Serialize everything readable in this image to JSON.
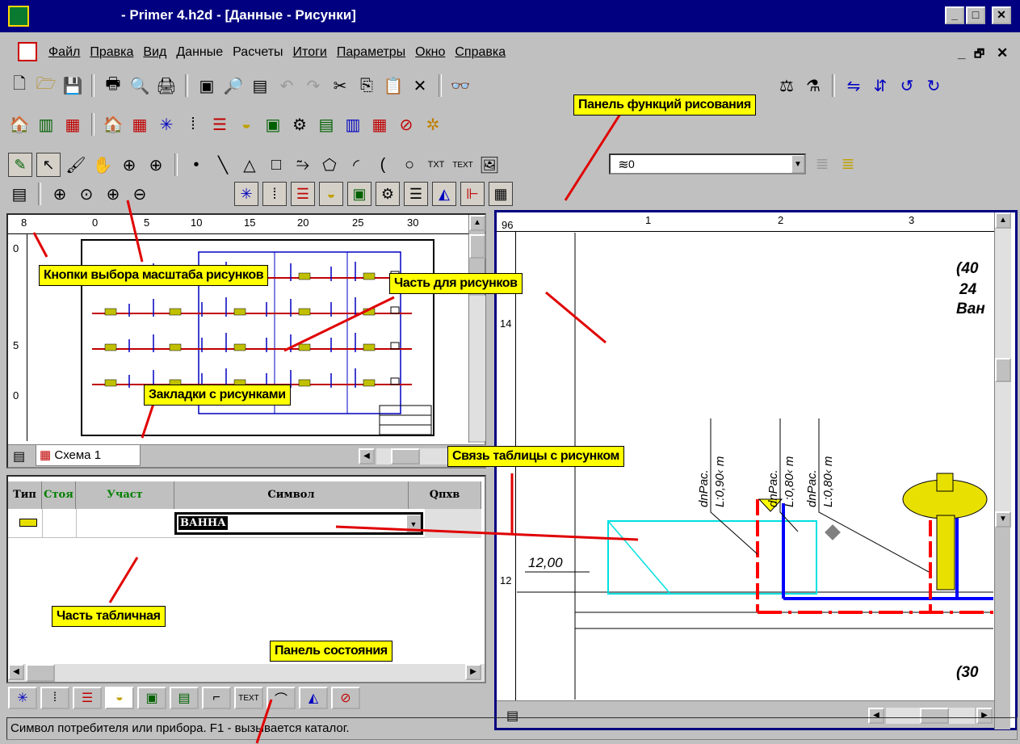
{
  "window": {
    "title": "- Primer 4.h2d - [Данные - Рисунки]",
    "min": "_",
    "max": "□",
    "close": "✕"
  },
  "menu": {
    "items": [
      "Файл",
      "Правка",
      "Вид",
      "Данные",
      "Расчеты",
      "Итоги",
      "Параметры",
      "Окно",
      "Справка"
    ],
    "mdi_min": "_",
    "mdi_restore": "🗗",
    "mdi_close": "✕"
  },
  "toolbar": {
    "layer_value": "0"
  },
  "left_pane": {
    "ruler_top": [
      "8",
      "0",
      "5",
      "10",
      "15",
      "20",
      "25",
      "30"
    ],
    "ruler_side": [
      "0",
      "5",
      "0"
    ],
    "tab_label": "Схема 1"
  },
  "right_pane": {
    "ruler_top": [
      "96",
      "1",
      "2",
      "3"
    ],
    "ruler_side": [
      "14",
      "12"
    ],
    "drawing_texts": {
      "num40": "(40",
      "line2": "24",
      "line3": "Ван",
      "num30": "(30",
      "elev": "12,00",
      "pipe1_a": "dnPac.",
      "pipe1_b": "L:0,90‹ m",
      "pipe2_a": "dnPac.",
      "pipe2_b": "L:0,80‹ m",
      "pipe3_a": "dnPac.",
      "pipe3_b": "L:0,80‹ m"
    }
  },
  "table": {
    "headers": [
      "Тип",
      "Стоя",
      "Участ",
      "Символ",
      "Qпхв"
    ],
    "row_value": "ВАННА"
  },
  "annotations": {
    "drawing_functions": "Панель функций рисования",
    "scale_buttons": "Кнопки выбора масштаба рисунков",
    "drawing_part": "Часть для рисунков",
    "drawing_tabs": "Закладки с рисунками",
    "table_link": "Связь таблицы с рисунком",
    "table_part": "Часть табличная",
    "status_panel": "Панель состояния"
  },
  "status": {
    "text": "Символ потребителя или прибора.  F1 - вызывается каталог."
  },
  "colors": {
    "title_bg": "#000080",
    "label_bg": "#ffff00",
    "pointer": "#e00000",
    "pipe_red": "#ff0000",
    "pipe_blue": "#0000ff",
    "cyan": "#00e0e0"
  }
}
